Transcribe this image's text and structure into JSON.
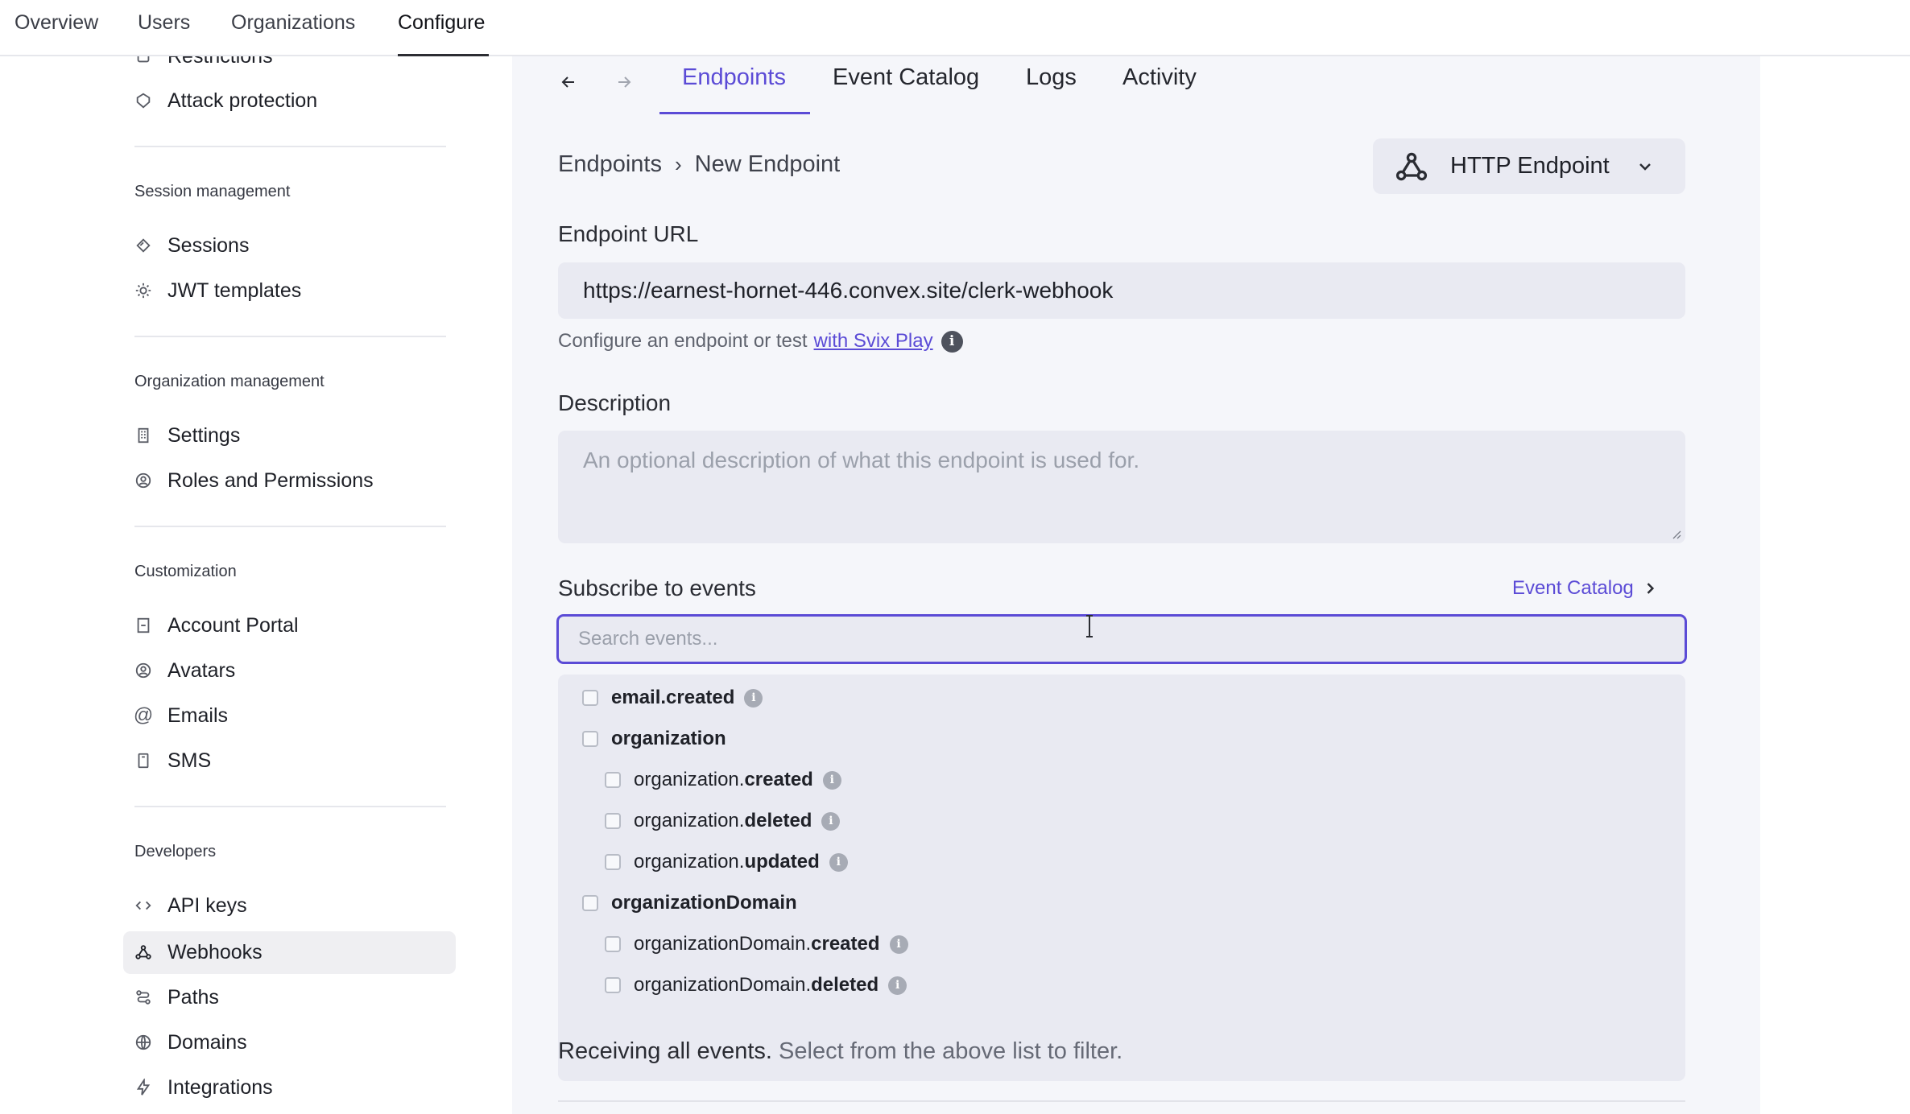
{
  "topnav": {
    "items": [
      {
        "label": "Overview"
      },
      {
        "label": "Users"
      },
      {
        "label": "Organizations"
      },
      {
        "label": "Configure"
      }
    ]
  },
  "sidebar": {
    "restrictions": "Restrictions",
    "attack_protection": "Attack protection",
    "session_section": "Session management",
    "sessions": "Sessions",
    "jwt_templates": "JWT templates",
    "org_section": "Organization management",
    "settings": "Settings",
    "roles": "Roles and Permissions",
    "custom_section": "Customization",
    "account_portal": "Account Portal",
    "avatars": "Avatars",
    "emails": "Emails",
    "sms": "SMS",
    "dev_section": "Developers",
    "api_keys": "API keys",
    "webhooks": "Webhooks",
    "paths": "Paths",
    "domains": "Domains",
    "integrations": "Integrations"
  },
  "main": {
    "tabs": [
      "Endpoints",
      "Event Catalog",
      "Logs",
      "Activity"
    ],
    "breadcrumb": {
      "root": "Endpoints",
      "separator": "›",
      "current": "New Endpoint"
    },
    "endpoint_type": "HTTP Endpoint",
    "endpoint_url_label": "Endpoint URL",
    "endpoint_url_value": "https://earnest-hornet-446.convex.site/clerk-webhook",
    "helper_text": "Configure an endpoint or test",
    "helper_link": "with Svix Play",
    "description_label": "Description",
    "description_placeholder": "An optional description of what this endpoint is used for.",
    "subscribe_label": "Subscribe to events",
    "event_catalog_link": "Event Catalog",
    "search_placeholder": "Search events...",
    "events": [
      {
        "prefix": "",
        "suffix": "email.created",
        "info": true
      },
      {
        "prefix": "",
        "suffix": "organization",
        "info": false
      },
      {
        "prefix": "organization.",
        "suffix": "created",
        "info": true
      },
      {
        "prefix": "organization.",
        "suffix": "deleted",
        "info": true
      },
      {
        "prefix": "organization.",
        "suffix": "updated",
        "info": true
      },
      {
        "prefix": "",
        "suffix": "organizationDomain",
        "info": false
      },
      {
        "prefix": "organizationDomain.",
        "suffix": "created",
        "info": true
      },
      {
        "prefix": "organizationDomain.",
        "suffix": "deleted",
        "info": true
      }
    ],
    "receiving_bold": "Receiving all events.",
    "receiving_muted": "Select from the above list to filter."
  },
  "colors": {
    "accent": "#5b4bd6",
    "panel_bg": "#f5f6fa",
    "input_bg": "#e9eaf2"
  }
}
